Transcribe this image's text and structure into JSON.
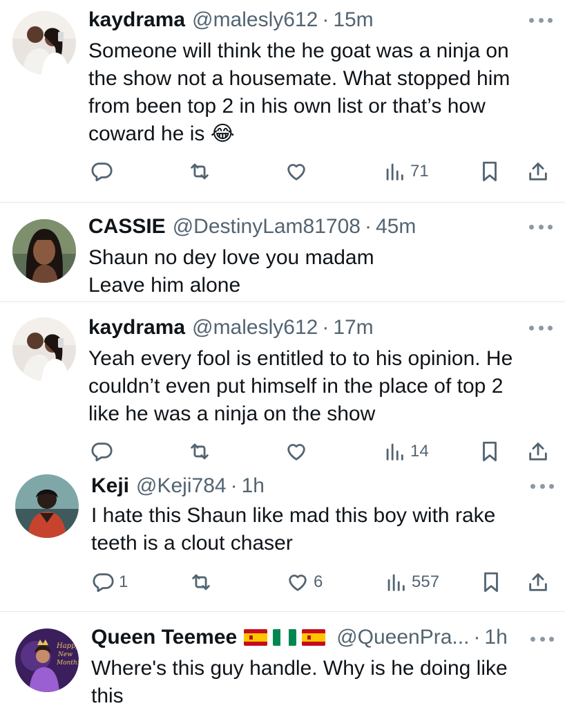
{
  "tweets": [
    {
      "name": "kaydrama",
      "handle": "@malesly612",
      "dot": "·",
      "time": "15m",
      "lines": [
        "Someone will think the he goat was a ninja on",
        "the show not a housemate. What stopped him",
        "from been top 2 in his own list or that’s how",
        "coward he is 😂"
      ],
      "actions": {
        "reply": "",
        "retweet": "",
        "like": "",
        "views": "71"
      }
    },
    {
      "name": "CASSIE",
      "handle": "@DestinyLam81708",
      "dot": "·",
      "time": "45m",
      "lines": [
        "Shaun no dey love you madam",
        "Leave him alone"
      ]
    },
    {
      "name": "kaydrama",
      "handle": "@malesly612",
      "dot": "·",
      "time": "17m",
      "lines": [
        "Yeah every fool is entitled to to his opinion. He",
        "couldn’t even put himself in the place of top 2",
        "like he was a ninja on the show"
      ],
      "actions": {
        "reply": "",
        "retweet": "",
        "like": "",
        "views": "14"
      }
    },
    {
      "name": "Keji",
      "handle": "@Keji784",
      "dot": "·",
      "time": "1h",
      "lines": [
        "I hate this Shaun like mad this boy with rake",
        "teeth is a clout chaser"
      ],
      "actions": {
        "reply": "1",
        "retweet": "",
        "like": "6",
        "views": "557"
      }
    },
    {
      "name": "Queen Teemee",
      "flags": [
        "spain-flag",
        "nigeria-flag",
        "spain-flag"
      ],
      "handle": "@QueenPra...",
      "dot": "·",
      "time": "1h",
      "lines": [
        "Where's this guy handle. Why is he doing like",
        "this"
      ]
    }
  ],
  "icons": {
    "reply": "reply-icon",
    "retweet": "retweet-icon",
    "like": "like-icon",
    "views": "views-icon",
    "bookmark": "bookmark-icon",
    "share": "share-icon",
    "more": "more-icon"
  },
  "colors": {
    "text": "#0f1419",
    "secondary": "#536471",
    "divider": "#e3e6e8"
  }
}
